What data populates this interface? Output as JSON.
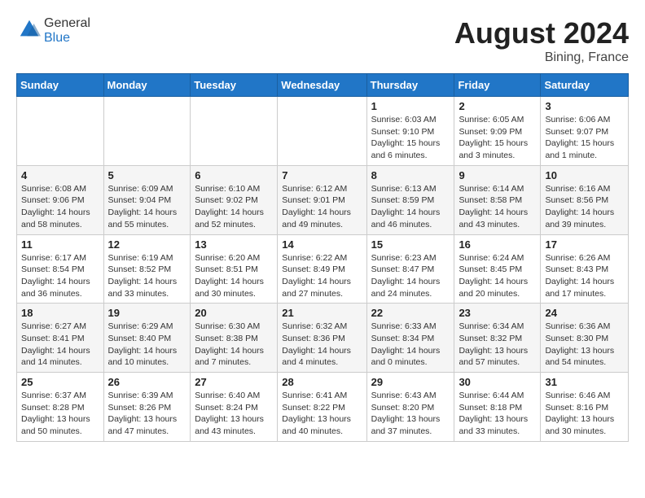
{
  "header": {
    "logo_general": "General",
    "logo_blue": "Blue",
    "month_year": "August 2024",
    "location": "Bining, France"
  },
  "weekdays": [
    "Sunday",
    "Monday",
    "Tuesday",
    "Wednesday",
    "Thursday",
    "Friday",
    "Saturday"
  ],
  "weeks": [
    [
      {
        "day": "",
        "info": ""
      },
      {
        "day": "",
        "info": ""
      },
      {
        "day": "",
        "info": ""
      },
      {
        "day": "",
        "info": ""
      },
      {
        "day": "1",
        "info": "Sunrise: 6:03 AM\nSunset: 9:10 PM\nDaylight: 15 hours and 6 minutes."
      },
      {
        "day": "2",
        "info": "Sunrise: 6:05 AM\nSunset: 9:09 PM\nDaylight: 15 hours and 3 minutes."
      },
      {
        "day": "3",
        "info": "Sunrise: 6:06 AM\nSunset: 9:07 PM\nDaylight: 15 hours and 1 minute."
      }
    ],
    [
      {
        "day": "4",
        "info": "Sunrise: 6:08 AM\nSunset: 9:06 PM\nDaylight: 14 hours and 58 minutes."
      },
      {
        "day": "5",
        "info": "Sunrise: 6:09 AM\nSunset: 9:04 PM\nDaylight: 14 hours and 55 minutes."
      },
      {
        "day": "6",
        "info": "Sunrise: 6:10 AM\nSunset: 9:02 PM\nDaylight: 14 hours and 52 minutes."
      },
      {
        "day": "7",
        "info": "Sunrise: 6:12 AM\nSunset: 9:01 PM\nDaylight: 14 hours and 49 minutes."
      },
      {
        "day": "8",
        "info": "Sunrise: 6:13 AM\nSunset: 8:59 PM\nDaylight: 14 hours and 46 minutes."
      },
      {
        "day": "9",
        "info": "Sunrise: 6:14 AM\nSunset: 8:58 PM\nDaylight: 14 hours and 43 minutes."
      },
      {
        "day": "10",
        "info": "Sunrise: 6:16 AM\nSunset: 8:56 PM\nDaylight: 14 hours and 39 minutes."
      }
    ],
    [
      {
        "day": "11",
        "info": "Sunrise: 6:17 AM\nSunset: 8:54 PM\nDaylight: 14 hours and 36 minutes."
      },
      {
        "day": "12",
        "info": "Sunrise: 6:19 AM\nSunset: 8:52 PM\nDaylight: 14 hours and 33 minutes."
      },
      {
        "day": "13",
        "info": "Sunrise: 6:20 AM\nSunset: 8:51 PM\nDaylight: 14 hours and 30 minutes."
      },
      {
        "day": "14",
        "info": "Sunrise: 6:22 AM\nSunset: 8:49 PM\nDaylight: 14 hours and 27 minutes."
      },
      {
        "day": "15",
        "info": "Sunrise: 6:23 AM\nSunset: 8:47 PM\nDaylight: 14 hours and 24 minutes."
      },
      {
        "day": "16",
        "info": "Sunrise: 6:24 AM\nSunset: 8:45 PM\nDaylight: 14 hours and 20 minutes."
      },
      {
        "day": "17",
        "info": "Sunrise: 6:26 AM\nSunset: 8:43 PM\nDaylight: 14 hours and 17 minutes."
      }
    ],
    [
      {
        "day": "18",
        "info": "Sunrise: 6:27 AM\nSunset: 8:41 PM\nDaylight: 14 hours and 14 minutes."
      },
      {
        "day": "19",
        "info": "Sunrise: 6:29 AM\nSunset: 8:40 PM\nDaylight: 14 hours and 10 minutes."
      },
      {
        "day": "20",
        "info": "Sunrise: 6:30 AM\nSunset: 8:38 PM\nDaylight: 14 hours and 7 minutes."
      },
      {
        "day": "21",
        "info": "Sunrise: 6:32 AM\nSunset: 8:36 PM\nDaylight: 14 hours and 4 minutes."
      },
      {
        "day": "22",
        "info": "Sunrise: 6:33 AM\nSunset: 8:34 PM\nDaylight: 14 hours and 0 minutes."
      },
      {
        "day": "23",
        "info": "Sunrise: 6:34 AM\nSunset: 8:32 PM\nDaylight: 13 hours and 57 minutes."
      },
      {
        "day": "24",
        "info": "Sunrise: 6:36 AM\nSunset: 8:30 PM\nDaylight: 13 hours and 54 minutes."
      }
    ],
    [
      {
        "day": "25",
        "info": "Sunrise: 6:37 AM\nSunset: 8:28 PM\nDaylight: 13 hours and 50 minutes."
      },
      {
        "day": "26",
        "info": "Sunrise: 6:39 AM\nSunset: 8:26 PM\nDaylight: 13 hours and 47 minutes."
      },
      {
        "day": "27",
        "info": "Sunrise: 6:40 AM\nSunset: 8:24 PM\nDaylight: 13 hours and 43 minutes."
      },
      {
        "day": "28",
        "info": "Sunrise: 6:41 AM\nSunset: 8:22 PM\nDaylight: 13 hours and 40 minutes."
      },
      {
        "day": "29",
        "info": "Sunrise: 6:43 AM\nSunset: 8:20 PM\nDaylight: 13 hours and 37 minutes."
      },
      {
        "day": "30",
        "info": "Sunrise: 6:44 AM\nSunset: 8:18 PM\nDaylight: 13 hours and 33 minutes."
      },
      {
        "day": "31",
        "info": "Sunrise: 6:46 AM\nSunset: 8:16 PM\nDaylight: 13 hours and 30 minutes."
      }
    ]
  ]
}
